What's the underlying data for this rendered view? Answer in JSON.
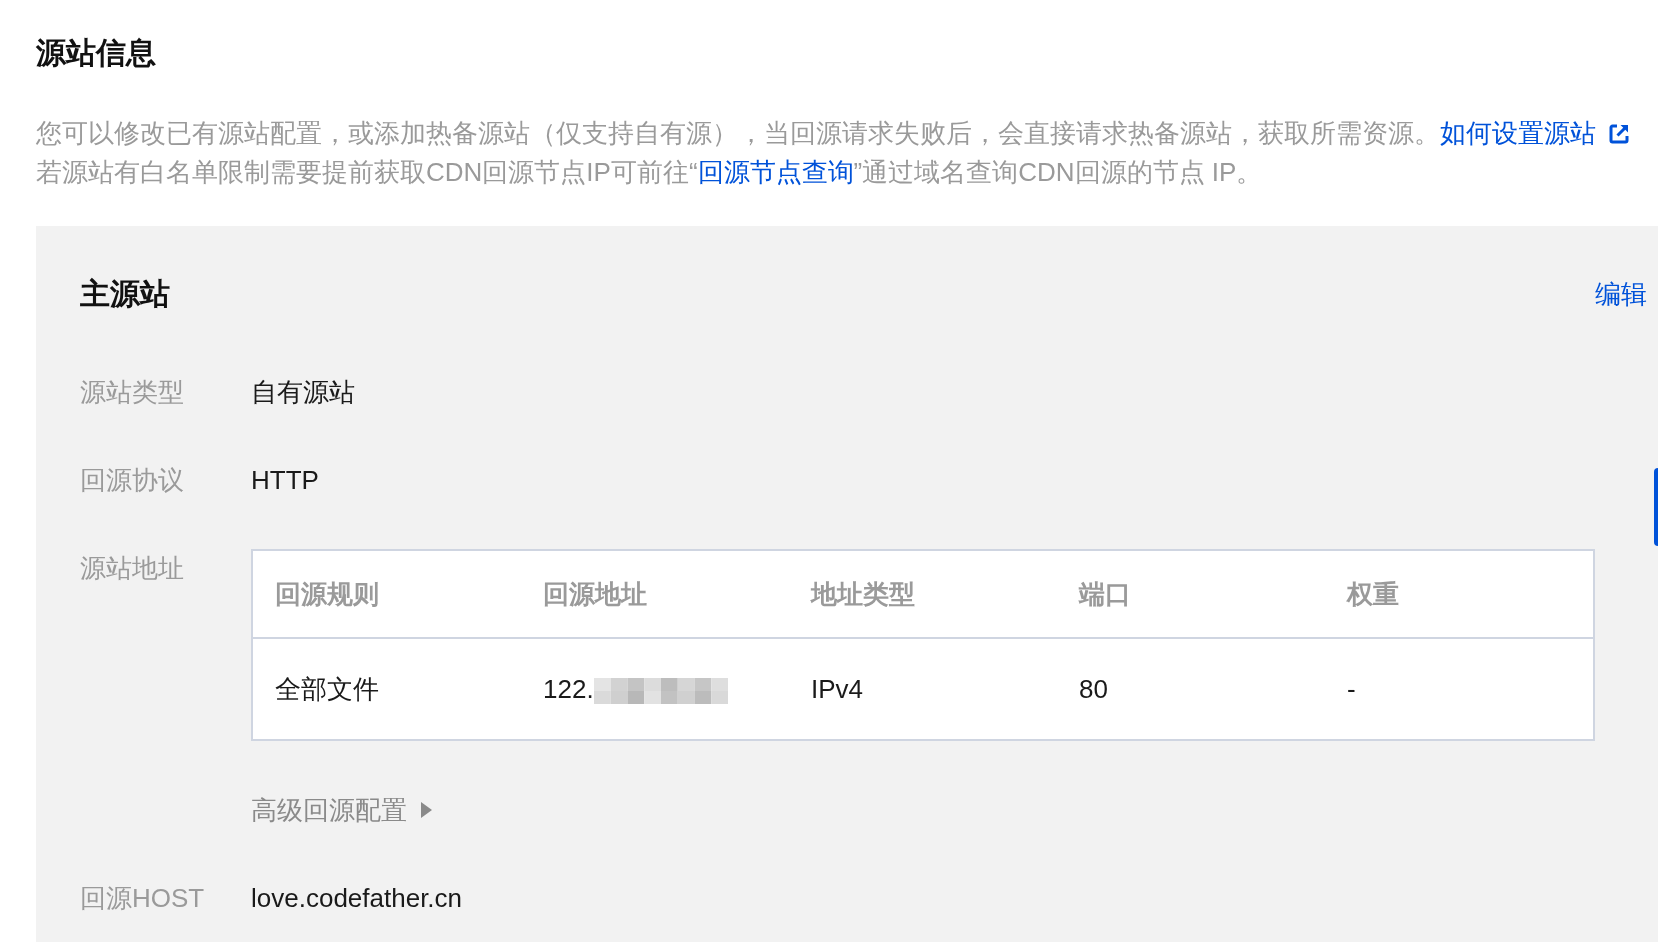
{
  "section": {
    "title": "源站信息",
    "description": [
      {
        "parts": [
          {
            "kind": "text",
            "text": "您可以修改已有源站配置，或添加热备源站（仅支持自有源），当回源请求失败后，会直接请求热备源站，获取所需资源。"
          },
          {
            "kind": "external_link",
            "text": "如何设置源站"
          }
        ]
      },
      {
        "parts": [
          {
            "kind": "text",
            "text": "若源站有白名单限制需要提前获取CDN回源节点IP可前往“"
          },
          {
            "kind": "link",
            "text": "回源节点查询"
          },
          {
            "kind": "text",
            "text": "”通过域名查询CDN回源的节点 IP。"
          }
        ]
      }
    ]
  },
  "origin_panel": {
    "title": "主源站",
    "edit_action": "编辑",
    "fields": [
      {
        "kind": "text",
        "label": "源站类型",
        "value": "自有源站"
      },
      {
        "kind": "text",
        "label": "回源协议",
        "value": "HTTP"
      },
      {
        "kind": "table",
        "label": "源站地址",
        "columns": [
          "回源规则",
          "回源地址",
          "地址类型",
          "端口",
          "权重"
        ],
        "rows": [
          {
            "cells": [
              {
                "text": "全部文件",
                "redacted": false
              },
              {
                "text": "122.",
                "redacted": true
              },
              {
                "text": "IPv4",
                "redacted": false
              },
              {
                "text": "80",
                "redacted": false
              },
              {
                "text": "-",
                "redacted": false
              }
            ]
          }
        ]
      },
      {
        "kind": "toggle",
        "text": "高级回源配置",
        "expanded": false
      },
      {
        "kind": "text",
        "label": "回源HOST",
        "value": "love.codefather.cn"
      }
    ]
  }
}
